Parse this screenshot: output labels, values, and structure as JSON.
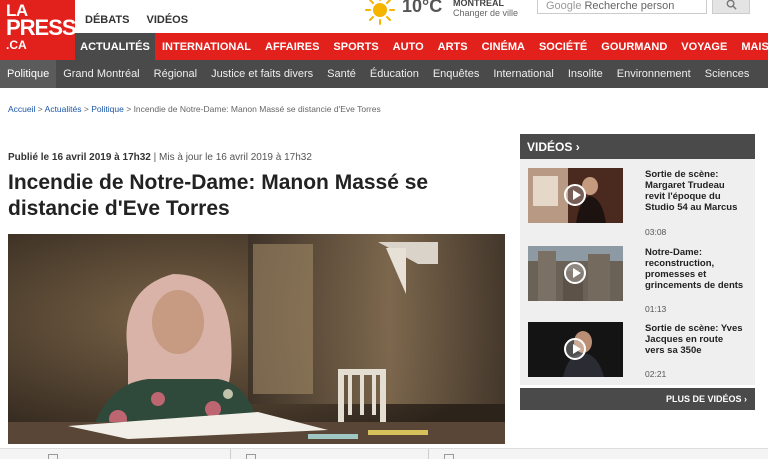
{
  "logo": {
    "line1": "LA",
    "line2": "PRESSE",
    "line3": ".CA"
  },
  "toplinks": [
    "DÉBATS",
    "VIDÉOS"
  ],
  "weather": {
    "temperature": "10°C",
    "city": "MONTRÉAL",
    "change_city": "Changer de ville",
    "icon": "sun-icon"
  },
  "search": {
    "engine_label": "Google",
    "placeholder": "Recherche person"
  },
  "nav_primary": {
    "active": "ACTUALITÉS",
    "items": [
      "INTERNATIONAL",
      "AFFAIRES",
      "SPORTS",
      "AUTO",
      "ARTS",
      "CINÉMA",
      "SOCIÉTÉ",
      "GOURMAND",
      "VOYAGE",
      "MAISON"
    ]
  },
  "nav_secondary": {
    "items": [
      "Politique",
      "Grand Montréal",
      "Régional",
      "Justice et faits divers",
      "Santé",
      "Éducation",
      "Enquêtes",
      "International",
      "Insolite",
      "Environnement",
      "Sciences"
    ]
  },
  "breadcrumb": {
    "items": [
      "Accueil",
      "Actualités",
      "Politique"
    ],
    "sep": ">",
    "current": "Incendie de Notre-Dame: Manon Massé se distancie d'Eve Torres"
  },
  "article": {
    "published_label": "Publié le 16 avril 2019 à 17h32",
    "updated_label": "| Mis à jour le 16 avril 2019 à 17h32",
    "headline": "Incendie de Notre-Dame: Manon Massé se distancie d'Eve Torres"
  },
  "videos": {
    "header": "VIDÉOS",
    "items": [
      {
        "title": "Sortie de scène: Margaret Trudeau revit l'époque du Studio 54 au Marcus",
        "duration": "03:08"
      },
      {
        "title": "Notre-Dame: reconstruction, promesses et grincements de dents",
        "duration": "01:13"
      },
      {
        "title": "Sortie de scène: Yves Jacques en route vers sa 350e",
        "duration": "02:21"
      }
    ],
    "more": "PLUS DE VIDÉOS ›"
  },
  "colors": {
    "brand_red": "#e2211c",
    "dark_gray": "#4a4a4a",
    "link_blue": "#1a56a8"
  }
}
